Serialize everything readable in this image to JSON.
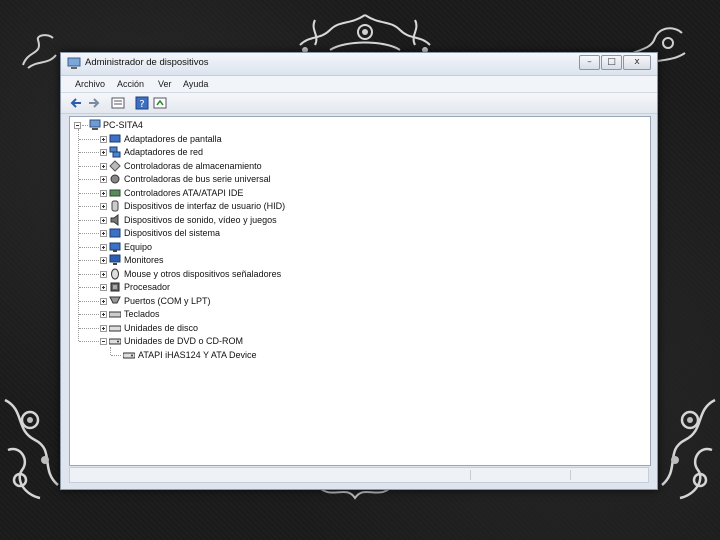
{
  "window": {
    "title": "Administrador de dispositivos",
    "controls": {
      "minimize": "–",
      "maximize": "□",
      "close": "x"
    }
  },
  "menu": [
    "Archivo",
    "Acción",
    "Ver",
    "Ayuda"
  ],
  "toolbar": {
    "buttons": [
      "back-arrow-icon",
      "forward-arrow-icon",
      "properties-icon",
      "help-icon",
      "update-driver-icon"
    ]
  },
  "tree": {
    "root": "PC-SITA4",
    "categories": [
      "Adaptadores de pantalla",
      "Adaptadores de red",
      "Controladoras de almacenamiento",
      "Controladoras de bus serie universal",
      "Controladores ATA/ATAPI IDE",
      "Dispositivos de interfaz de usuario (HID)",
      "Dispositivos de sonido, vídeo y juegos",
      "Dispositivos del sistema",
      "Equipo",
      "Monitores",
      "Mouse y otros dispositivos señaladores",
      "Procesador",
      "Puertos (COM y LPT)",
      "Teclados",
      "Unidades de disco",
      "Unidades de DVD o CD-ROM"
    ],
    "child": "ATAPI iHAS124   Y ATA Device"
  },
  "colors": {
    "background": "#1c1c1c",
    "window": "#dfe5ee",
    "accent": "#2a5db0"
  }
}
